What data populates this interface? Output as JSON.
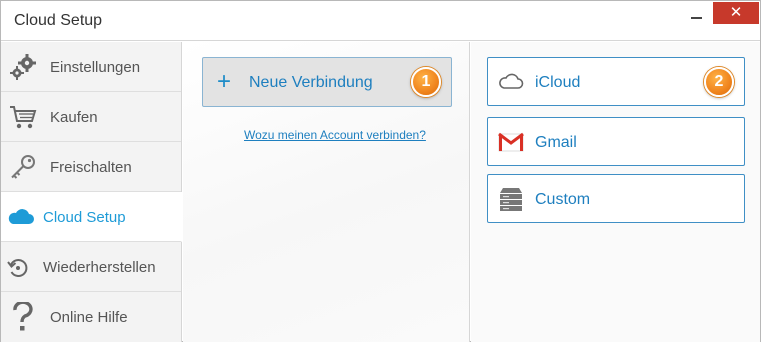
{
  "window": {
    "title": "Cloud Setup",
    "close_glyph": "✕"
  },
  "sidebar": {
    "items": [
      {
        "label": "Einstellungen",
        "icon": "gears-icon"
      },
      {
        "label": "Kaufen",
        "icon": "cart-icon"
      },
      {
        "label": "Freischalten",
        "icon": "key-icon"
      },
      {
        "label": "Cloud Setup",
        "icon": "cloud-icon",
        "active": true
      },
      {
        "label": "Wiederherstellen",
        "icon": "restore-icon"
      },
      {
        "label": "Online Hilfe",
        "icon": "question-icon"
      }
    ]
  },
  "main": {
    "new_connection": {
      "plus": "+",
      "label": "Neue Verbindung",
      "badge": "1"
    },
    "help_link": "Wozu meinen Account verbinden?"
  },
  "services": {
    "badge": "2",
    "items": [
      {
        "label": "iCloud",
        "icon": "cloud-outline-icon"
      },
      {
        "label": "Gmail",
        "icon": "gmail-icon"
      },
      {
        "label": "Custom",
        "icon": "server-icon"
      }
    ]
  },
  "colors": {
    "accent": "#1e9bd7",
    "badge": "#f0851e",
    "close": "#c7392b",
    "gmail_red": "#d93025"
  }
}
